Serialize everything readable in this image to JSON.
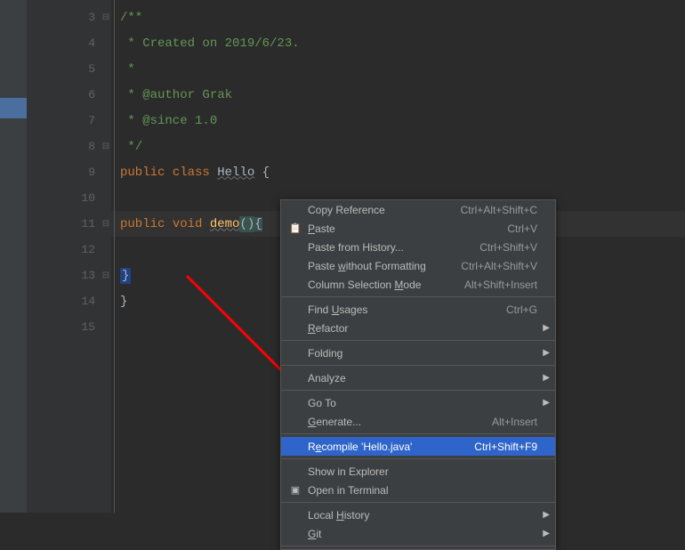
{
  "gutter": {
    "lines": [
      "3",
      "4",
      "5",
      "6",
      "7",
      "8",
      "9",
      "10",
      "11",
      "12",
      "13",
      "14",
      "15"
    ]
  },
  "code": {
    "line3": "/**",
    "line4": " * Created on 2019/6/23.",
    "line5": " *",
    "line6": " * @author Grak",
    "line7": " * @since 1.0",
    "line8": " */",
    "line9_public": "public ",
    "line9_class": "class ",
    "line9_name": "Hello",
    "line9_brace": " {",
    "line11_public": "public ",
    "line11_void": "void ",
    "line11_method": "demo",
    "line11_paren": "()",
    "line11_brace": "{",
    "line13_brace": "}",
    "line14_brace": "}"
  },
  "menu": {
    "copyRef": {
      "label": "Copy Reference",
      "shortcut": "Ctrl+Alt+Shift+C"
    },
    "paste": {
      "label": "aste",
      "prefix": "P",
      "shortcut": "Ctrl+V"
    },
    "pasteHistory": {
      "label": "Paste from History...",
      "shortcut": "Ctrl+Shift+V"
    },
    "pastePlain": {
      "prefix": "Paste ",
      "u": "w",
      "suffix": "ithout Formatting",
      "shortcut": "Ctrl+Alt+Shift+V"
    },
    "colMode": {
      "prefix": "Column Selection ",
      "u": "M",
      "suffix": "ode",
      "shortcut": "Alt+Shift+Insert"
    },
    "findUsages": {
      "prefix": "Find ",
      "u": "U",
      "suffix": "sages",
      "shortcut": "Ctrl+G"
    },
    "refactor": {
      "u": "R",
      "suffix": "efactor"
    },
    "folding": {
      "label": "Folding"
    },
    "analyze": {
      "label": "Analyze"
    },
    "goto": {
      "label": "Go To"
    },
    "generate": {
      "u": "G",
      "suffix": "enerate...",
      "shortcut": "Alt+Insert"
    },
    "recompile": {
      "prefix": "R",
      "u": "e",
      "suffix": "compile 'Hello.java'",
      "shortcut": "Ctrl+Shift+F9"
    },
    "showExplorer": {
      "label": "Show in Explorer"
    },
    "openTerminal": {
      "label": "Open in Terminal"
    },
    "localHistory": {
      "prefix": "Local ",
      "u": "H",
      "suffix": "istory"
    },
    "git": {
      "u": "G",
      "suffix": "it"
    }
  }
}
